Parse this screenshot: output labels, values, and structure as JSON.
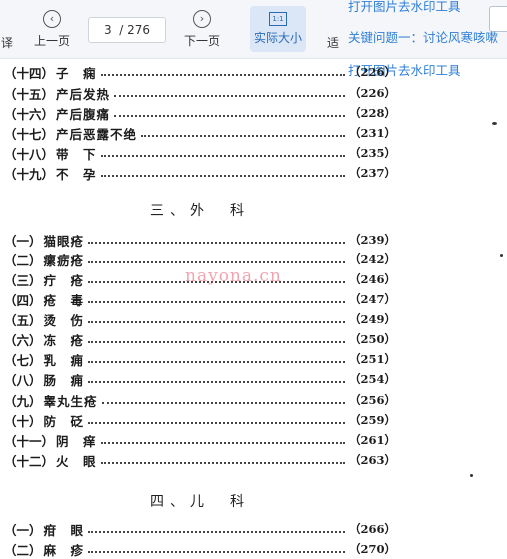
{
  "toolbar": {
    "left_partial": "译",
    "prev_label": "上一页",
    "current_page": "3",
    "total_pages": "/ 276",
    "next_label": "下一页",
    "actual_size_label": "实际大小",
    "actual_size_box": "1:1",
    "right_partial": "适"
  },
  "links": [
    "打开图片去水印工具",
    "关键问题一：讨论风寒咳嗽",
    "打开图片去水印工具"
  ],
  "watermark": "nayona.cn",
  "entries_top": [
    {
      "num": "（十四）",
      "title": "子　痫",
      "page": "（226）"
    },
    {
      "num": "（十五）",
      "title": "产后发热",
      "page": "（226）"
    },
    {
      "num": "（十六）",
      "title": "产后腹痛",
      "page": "（228）"
    },
    {
      "num": "（十七）",
      "title": "产后恶露不绝",
      "page": "（231）"
    },
    {
      "num": "（十八）",
      "title": "带　下",
      "page": "（235）"
    },
    {
      "num": "（十九）",
      "title": "不　孕",
      "page": "（237）"
    }
  ],
  "section_surgery": "三、外　科",
  "entries_surgery": [
    {
      "num": "（一）",
      "title": "猫眼疮",
      "page": "（239）"
    },
    {
      "num": "（二）",
      "title": "瘰疬疮",
      "page": "（242）"
    },
    {
      "num": "（三）",
      "title": "疔　疮",
      "page": "（246）"
    },
    {
      "num": "（四）",
      "title": "疮　毒",
      "page": "（247）"
    },
    {
      "num": "（五）",
      "title": "烫　伤",
      "page": "（249）"
    },
    {
      "num": "（六）",
      "title": "冻　疮",
      "page": "（250）"
    },
    {
      "num": "（七）",
      "title": "乳　痈",
      "page": "（251）"
    },
    {
      "num": "（八）",
      "title": "肠　痈",
      "page": "（254）"
    },
    {
      "num": "（九）",
      "title": "睾丸生疮",
      "page": "（256）"
    },
    {
      "num": "（十）",
      "title": "防　砭",
      "page": "（259）"
    },
    {
      "num": "（十一）",
      "title": "阴　痒",
      "page": "（261）"
    },
    {
      "num": "（十二）",
      "title": "火　眼",
      "page": "（263）"
    }
  ],
  "section_pediatrics": "四、儿　科",
  "entries_pediatrics": [
    {
      "num": "（一）",
      "title": "疳　眼",
      "page": "（266）"
    },
    {
      "num": "（二）",
      "title": "麻　疹",
      "page": "（270）"
    }
  ]
}
